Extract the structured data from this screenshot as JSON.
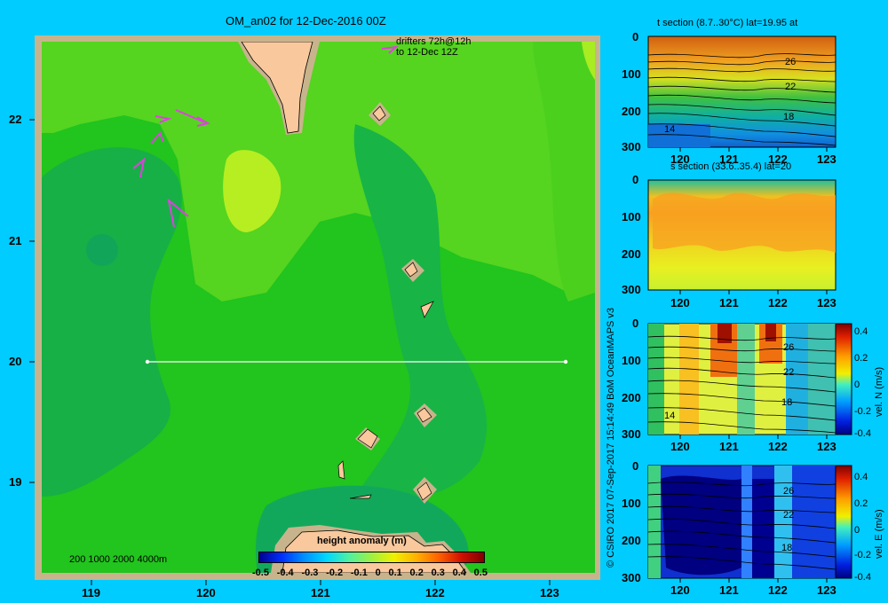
{
  "map": {
    "title": "OM_an02 for 12-Dec-2016 00Z",
    "drifter_note_line1": "drifters 72h@12h",
    "drifter_note_line2": "to 12-Dec 12Z",
    "x_ticks": [
      "119",
      "120",
      "121",
      "122",
      "123"
    ],
    "y_ticks": [
      "22",
      "21",
      "20",
      "19"
    ],
    "depth_legend": "200  1000  2000  4000m",
    "colorbar_title": "height anomaly (m)",
    "colorbar_labels": [
      "-0.5",
      "-0.4",
      "-0.3",
      "-0.2",
      "-0.1",
      "0",
      "0.1",
      "0.2",
      "0.3",
      "0.4",
      "0.5"
    ],
    "section_line": {
      "lon_start": 119.5,
      "lon_end": 123.2,
      "lat": 20
    }
  },
  "credit": "© CSIRO 2017   07-Sep-2017 15:14:49 BoM OceanMAPS v3",
  "panels": {
    "t": {
      "title": "t section (8.7..30°C) lat=19.95 at",
      "contour_labels": [
        "26",
        "22",
        "18",
        "14"
      ]
    },
    "s": {
      "title": "s section (33.6..35.4) lat=20"
    },
    "vn": {
      "colorbar_label": "vel. N  (m/s)",
      "contour_labels": [
        "26",
        "22",
        "18",
        "14"
      ]
    },
    "ve": {
      "colorbar_label": "vel. E  (m/s)",
      "contour_labels": [
        "26",
        "22",
        "18"
      ]
    },
    "x_ticks": [
      "120",
      "121",
      "122",
      "123"
    ],
    "y_ticks": [
      "0",
      "100",
      "200",
      "300"
    ],
    "cbar_ticks": [
      "0.4",
      "0.2",
      "0",
      "-0.2",
      "-0.4"
    ]
  },
  "colors": {
    "background": "#00ccff",
    "land": "#f9c89d",
    "shelf": "#c8b48c"
  },
  "chart_data": [
    {
      "type": "heatmap",
      "title": "OM_an02 for 12-Dec-2016 00Z",
      "xlabel": "",
      "ylabel": "",
      "xlim": [
        118.5,
        123.5
      ],
      "ylim": [
        18.3,
        22.7
      ],
      "colorbar": {
        "label": "height anomaly (m)",
        "range": [
          -0.5,
          0.5
        ]
      },
      "dominant_values_m": {
        "basin": 0.15,
        "northwest_high": 0.25,
        "west_lows": 0.05
      }
    },
    {
      "type": "heatmap",
      "title": "t section (8.7..30°C) lat=19.95 at",
      "xlim": [
        119.5,
        123.2
      ],
      "ylim": [
        300,
        0
      ],
      "contours": [
        26,
        22,
        18,
        14
      ]
    },
    {
      "type": "heatmap",
      "title": "s section (33.6..35.4) lat=20",
      "xlim": [
        119.5,
        123.2
      ],
      "ylim": [
        300,
        0
      ]
    },
    {
      "type": "heatmap",
      "title": "vel. N (m/s)",
      "xlim": [
        119.5,
        123.2
      ],
      "ylim": [
        300,
        0
      ],
      "clim": [
        -0.4,
        0.4
      ]
    },
    {
      "type": "heatmap",
      "title": "vel. E (m/s)",
      "xlim": [
        119.5,
        123.2
      ],
      "ylim": [
        300,
        0
      ],
      "clim": [
        -0.4,
        0.4
      ]
    }
  ]
}
